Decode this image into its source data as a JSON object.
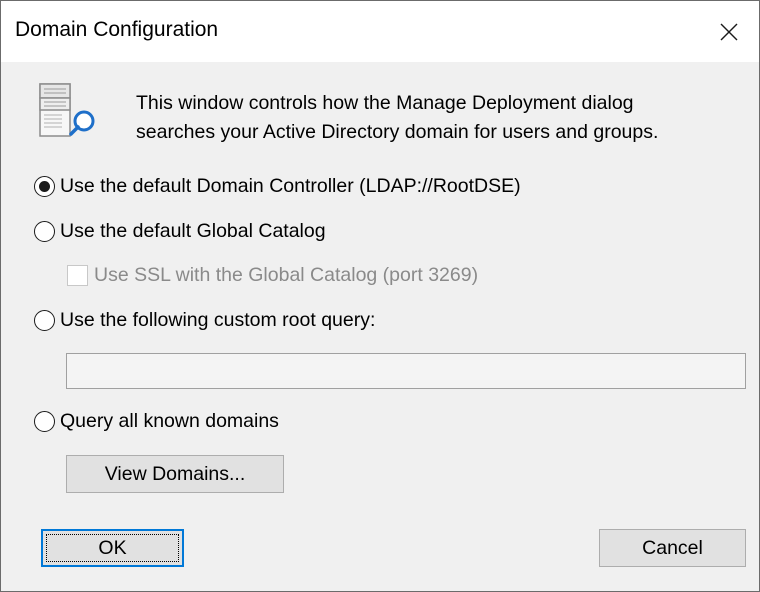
{
  "window": {
    "title": "Domain Configuration"
  },
  "description": {
    "line1": "This window controls how the Manage Deployment dialog",
    "line2": "searches your Active Directory domain for users and groups."
  },
  "options": {
    "default_dc": {
      "label": "Use the default Domain Controller (LDAP://RootDSE)",
      "checked": true
    },
    "global_catalog": {
      "label": "Use the default Global Catalog",
      "checked": false
    },
    "ssl_checkbox": {
      "label": "Use SSL with the Global Catalog (port 3269)",
      "checked": false,
      "enabled": false
    },
    "custom_query": {
      "label": "Use the following custom root query:",
      "checked": false
    },
    "custom_query_input": {
      "value": "",
      "enabled": false
    },
    "all_domains": {
      "label": "Query all known domains",
      "checked": false
    }
  },
  "buttons": {
    "view_domains": "View Domains...",
    "ok": "OK",
    "cancel": "Cancel"
  },
  "colors": {
    "accent": "#0078d7",
    "dialog_bg": "#f0f0f0",
    "disabled_text": "#8a8a8a"
  },
  "icons": {
    "close": "close-icon",
    "header": "server-search-icon"
  }
}
